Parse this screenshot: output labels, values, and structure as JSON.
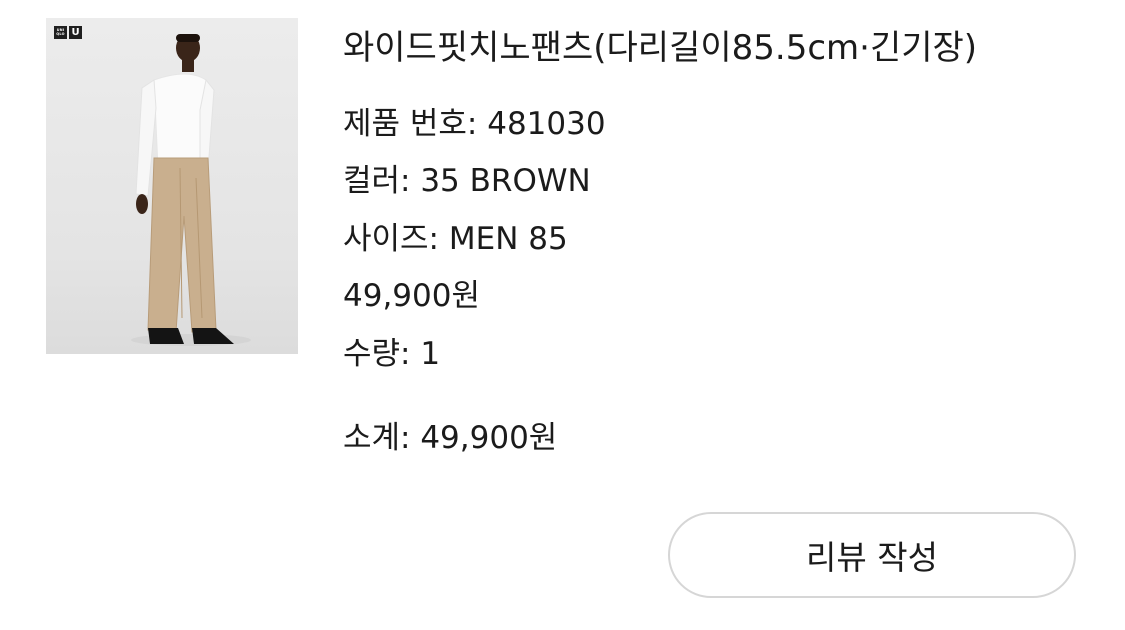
{
  "product": {
    "brand_logo": {
      "uniqlo_lines": [
        "UNI",
        "QLO"
      ],
      "sub_logo": "U"
    },
    "name": "와이드핏치노팬츠(다리길이85.5cm·긴기장)",
    "product_number": "제품 번호: 481030",
    "color": "컬러: 35 BROWN",
    "size": "사이즈: MEN 85",
    "price": "49,900원",
    "quantity": "수량: 1",
    "subtotal": "소계: 49,900원"
  },
  "actions": {
    "write_review_label": "리뷰 작성"
  },
  "colors": {
    "text": "#1b1b1b",
    "button_border": "#d6d6d6",
    "background": "#ffffff"
  }
}
